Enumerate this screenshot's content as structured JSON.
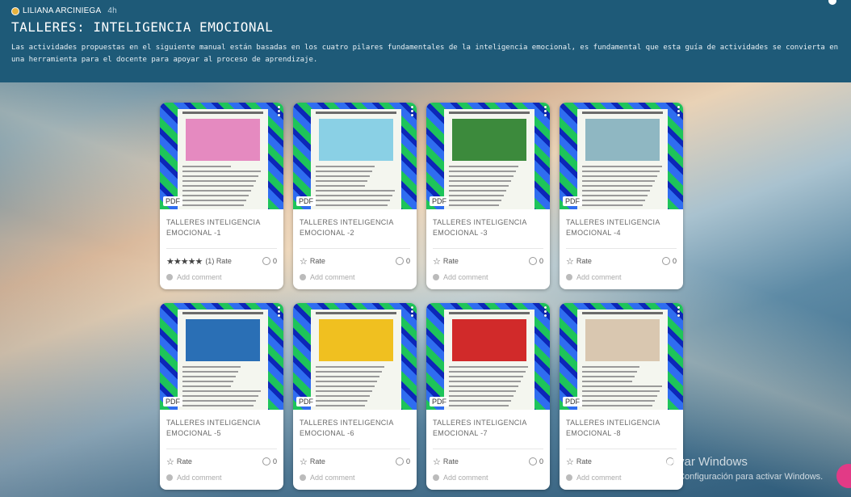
{
  "header": {
    "author": "LILIANA ARCINIEGA",
    "time": "4h",
    "title": "TALLERES: INTELIGENCIA EMOCIONAL",
    "description": "Las actividades propuestas en el siguiente manual están basadas en los cuatro pilares fundamentales de la inteligencia emocional, es fundamental que esta guía de actividades se convierta en una herramienta para el docente para apoyar al proceso de aprendizaje."
  },
  "cards": [
    {
      "title": "TALLERES INTELIGENCIA EMOCIONAL -1",
      "badge": "PDF",
      "rating_stars": "★★★★★",
      "rating_text": "(1) Rate",
      "comments": "0",
      "add_comment": "Add comment",
      "accent": "#e58ac0"
    },
    {
      "title": "TALLERES INTELIGENCIA EMOCIONAL -2",
      "badge": "PDF",
      "rating_stars": "",
      "rating_text": "Rate",
      "comments": "0",
      "add_comment": "Add comment",
      "accent": "#8ad0e5"
    },
    {
      "title": "TALLERES INTELIGENCIA EMOCIONAL -3",
      "badge": "PDF",
      "rating_stars": "",
      "rating_text": "Rate",
      "comments": "0",
      "add_comment": "Add comment",
      "accent": "#3c8a3c"
    },
    {
      "title": "TALLERES INTELIGENCIA EMOCIONAL -4",
      "badge": "PDF",
      "rating_stars": "",
      "rating_text": "Rate",
      "comments": "0",
      "add_comment": "Add comment",
      "accent": "#8fb7c2"
    },
    {
      "title": "TALLERES INTELIGENCIA EMOCIONAL -5",
      "badge": "PDF",
      "rating_stars": "",
      "rating_text": "Rate",
      "comments": "0",
      "add_comment": "Add comment",
      "accent": "#2a6fb5"
    },
    {
      "title": "TALLERES INTELIGENCIA EMOCIONAL -6",
      "badge": "PDF",
      "rating_stars": "",
      "rating_text": "Rate",
      "comments": "0",
      "add_comment": "Add comment",
      "accent": "#f0c020"
    },
    {
      "title": "TALLERES INTELIGENCIA EMOCIONAL -7",
      "badge": "PDF",
      "rating_stars": "",
      "rating_text": "Rate",
      "comments": "0",
      "add_comment": "Add comment",
      "accent": "#d12a2a"
    },
    {
      "title": "TALLERES INTELIGENCIA EMOCIONAL -8",
      "badge": "PDF",
      "rating_stars": "",
      "rating_text": "Rate",
      "comments": "",
      "add_comment": "Add comment",
      "accent": "#d9c7b0"
    }
  ],
  "watermark": {
    "line1": "Activar Windows",
    "line2": "Ve a Configuración para activar Windows."
  },
  "colors": {
    "header_bg": "#1e5a78",
    "fab": "#e23a86"
  },
  "icons": {
    "star": "star-icon",
    "comment": "comment-icon",
    "menu": "more-vert-icon"
  }
}
